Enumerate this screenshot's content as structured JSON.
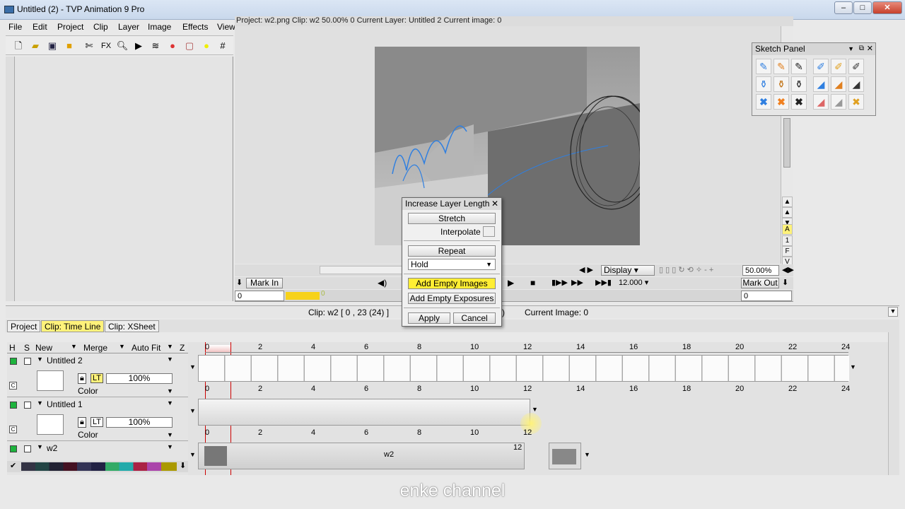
{
  "window": {
    "title": "Untitled (2) - TVP Animation 9 Pro"
  },
  "menu": [
    "File",
    "Edit",
    "Project",
    "Clip",
    "Layer",
    "Image",
    "Effects",
    "View"
  ],
  "toolbar_icons": [
    "new-file-icon",
    "open-icon",
    "save-icon",
    "folder-icon",
    "tools-icon",
    "fx-icon",
    "zoom-icon",
    "play-icon",
    "layers-icon",
    "color-wheel-icon",
    "frame-icon",
    "light-icon",
    "grid-icon"
  ],
  "toolbar_fx": "FX",
  "project_info": "Project: w2.png  Clip: w2  50.00%  0  Current Layer: Untitled 2  Current image: 0",
  "viewbar": {
    "display_label": "Display",
    "zoom": "50.00%",
    "side_a": "A",
    "side_1": "1",
    "side_f": "F",
    "side_v": "V"
  },
  "playbar": {
    "mark_in": "Mark In",
    "mark_out": "Mark Out",
    "in_value": "0",
    "out_value": "0",
    "fps": "12.000",
    "ruler_zero": "0"
  },
  "status": {
    "clip_info": "Clip: w2 [ 0 , 23  (24) ]",
    "paren": ")",
    "current_image": "Current Image: 0"
  },
  "tabs": [
    "Project",
    "Clip: Time Line",
    "Clip: XSheet"
  ],
  "timeline_header": {
    "h": "H",
    "s": "S",
    "new": "New",
    "merge": "Merge",
    "autofit": "Auto Fit",
    "z": "Z"
  },
  "layers": [
    {
      "name": "Untitled 2",
      "opacity": "100%",
      "mode": "Color",
      "lt": "LT"
    },
    {
      "name": "Untitled 1",
      "opacity": "100%",
      "mode": "Color",
      "lt": "LT"
    },
    {
      "name": "w2"
    }
  ],
  "ruler_labels": [
    "0",
    "2",
    "4",
    "6",
    "8",
    "10",
    "12",
    "14",
    "16",
    "18",
    "20",
    "22",
    "24"
  ],
  "ruler_labels_short": [
    "0",
    "2",
    "4",
    "6",
    "8",
    "10",
    "12"
  ],
  "track_w2": {
    "label": "w2",
    "end_label": "12"
  },
  "dialog": {
    "title": "Increase Layer Length",
    "stretch": "Stretch",
    "interpolate": "Interpolate",
    "repeat": "Repeat",
    "hold": "Hold",
    "add_empty_images": "Add Empty Images",
    "add_empty_exposures": "Add Empty Exposures",
    "apply": "Apply",
    "cancel": "Cancel"
  },
  "sketch_panel": {
    "title": "Sketch Panel",
    "tools": [
      "pencil-icon",
      "crayon-icon",
      "marker-icon",
      "airbrush-icon",
      "paint-brush-icon",
      "brush-icon",
      "ink-bottle-icon",
      "ink-bottle-orange-icon",
      "ink-bottle-black-icon",
      "eraser-blue-icon",
      "eraser-orange-icon",
      "eraser-black-icon",
      "delete-blue-icon",
      "delete-orange-icon",
      "delete-black-icon",
      "eraser-pink-icon",
      "eraser-white-icon",
      "delete-yellow-icon"
    ]
  },
  "watermark": "enke channel",
  "colors": {
    "active_tab": "#fff27a",
    "highlight_btn": "#ffee33",
    "blue_sketch": "#2f7fe0"
  }
}
